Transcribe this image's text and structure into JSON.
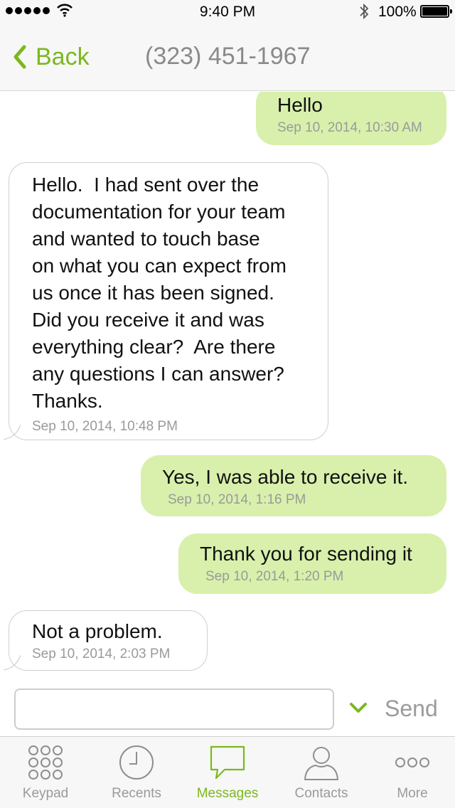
{
  "status_bar": {
    "time": "9:40 PM",
    "battery": "100%"
  },
  "nav": {
    "back_label": "Back",
    "title": "(323) 451-1967"
  },
  "messages": [
    {
      "direction": "outgoing",
      "text": "Hello",
      "time": "Sep 10, 2014, 10:30 AM"
    },
    {
      "direction": "incoming",
      "text": "Hello.  I had sent over the\ndocumentation for your team\nand wanted to touch base\non what you can expect from\nus once it has been signed.\nDid you receive it and was\neverything clear?  Are there\nany questions I can answer?\nThanks.",
      "time": "Sep 10, 2014, 10:48 PM"
    },
    {
      "direction": "outgoing",
      "text": "Yes, I was able to receive it.",
      "time": "Sep 10, 2014, 1:16 PM"
    },
    {
      "direction": "outgoing",
      "text": "Thank you for sending it",
      "time": "Sep 10, 2014, 1:20 PM"
    },
    {
      "direction": "incoming",
      "text": "Not a problem.",
      "time": "Sep 10, 2014, 2:03 PM"
    }
  ],
  "composer": {
    "value": "",
    "send_label": "Send"
  },
  "tabs": [
    {
      "label": "Keypad",
      "icon": "keypad-icon"
    },
    {
      "label": "Recents",
      "icon": "clock-icon"
    },
    {
      "label": "Messages",
      "icon": "speech-bubble-icon",
      "active": true
    },
    {
      "label": "Contacts",
      "icon": "person-icon"
    },
    {
      "label": "More",
      "icon": "more-icon"
    }
  ],
  "colors": {
    "accent": "#7bb81d",
    "outgoing_bubble": "#d8f0ac",
    "incoming_bubble": "#ffffff"
  }
}
